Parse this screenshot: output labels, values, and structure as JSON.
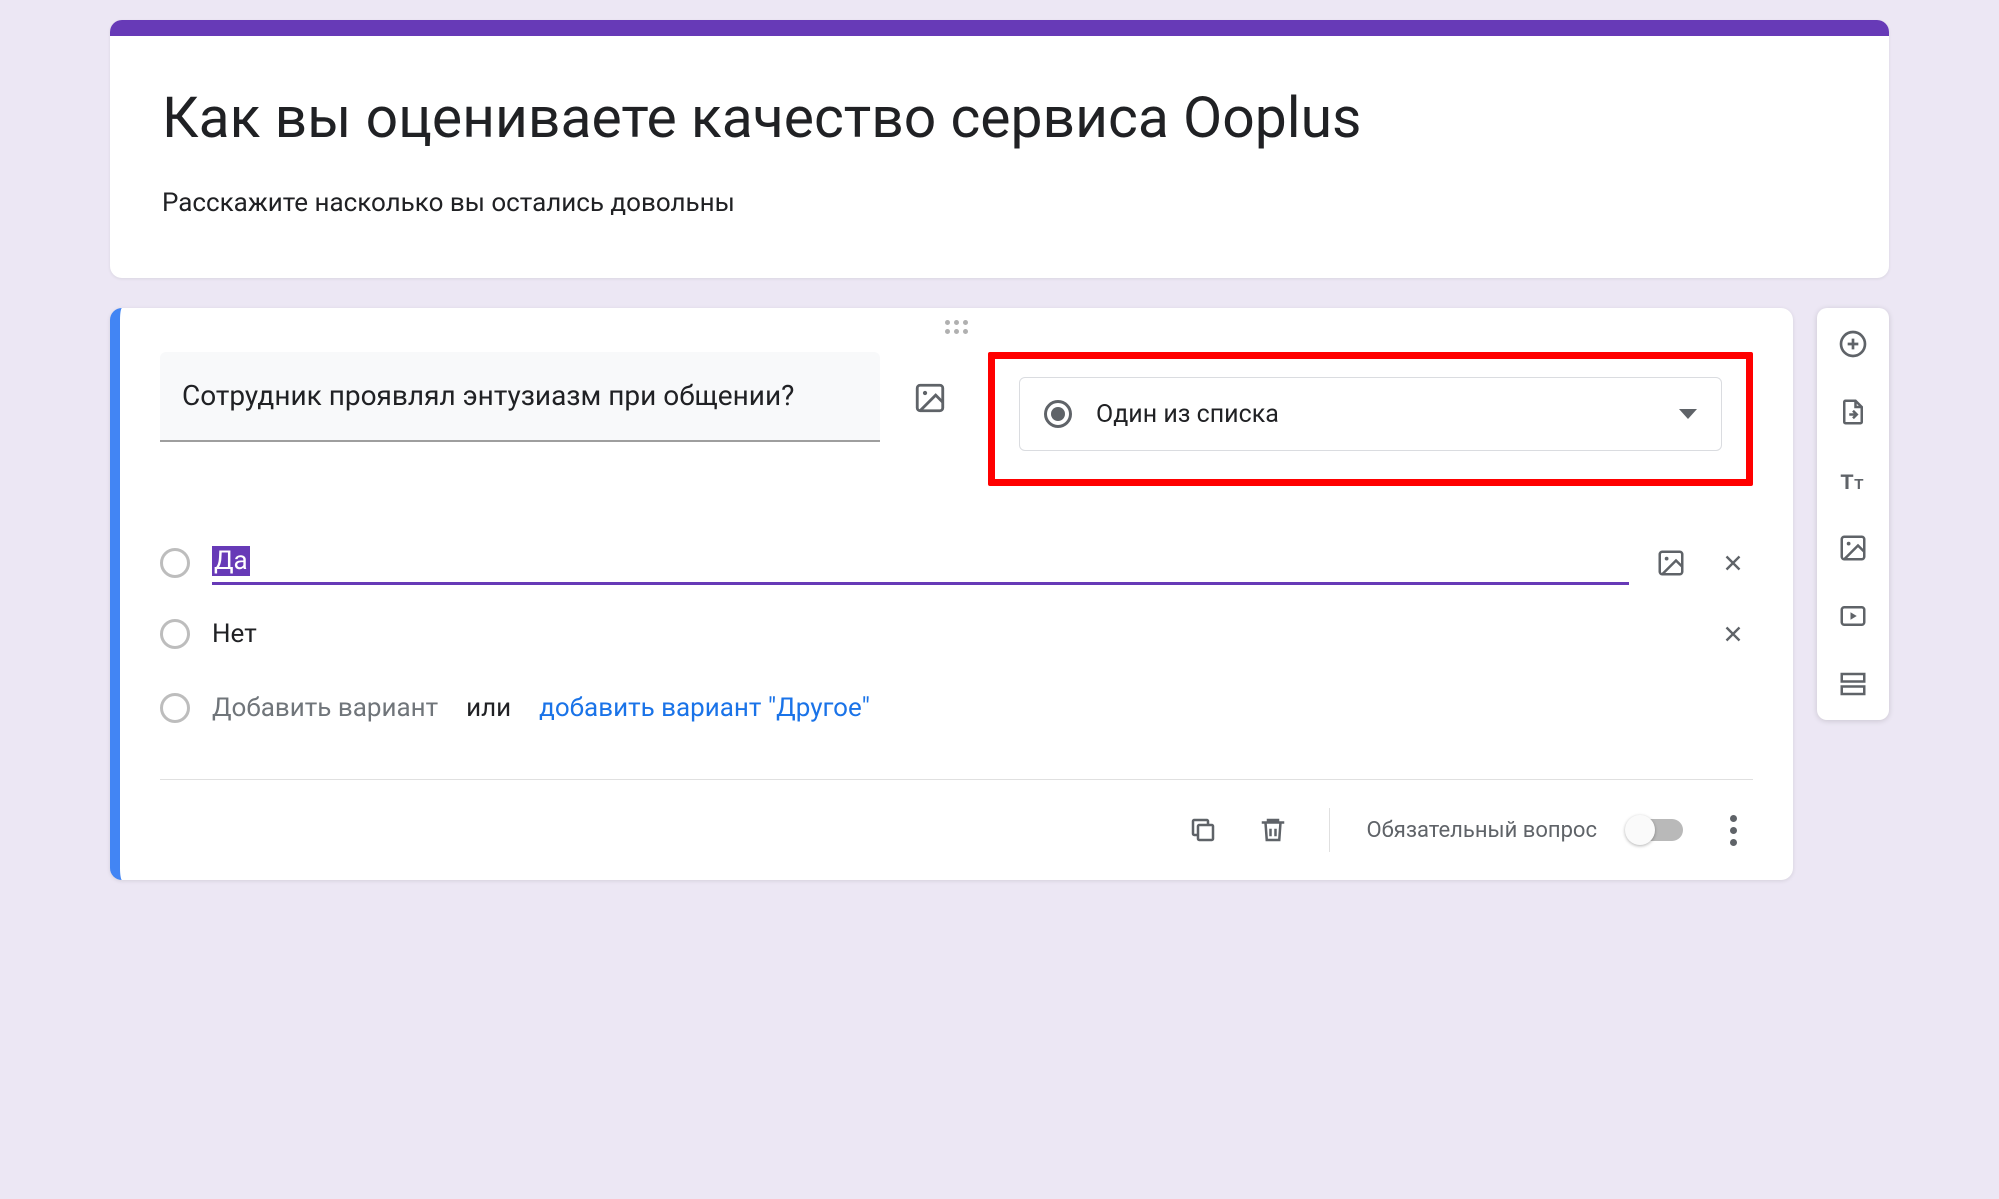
{
  "header": {
    "title": "Как вы оцениваете качество сервиса Ooplus",
    "description": "Расскажите насколько вы остались довольны"
  },
  "question": {
    "text": "Сотрудник проявлял энтузиазм при общении?",
    "type_label": "Один из списка",
    "options": [
      {
        "label": "Да",
        "selected": true
      },
      {
        "label": "Нет",
        "selected": false
      }
    ],
    "add_option_text": "Добавить вариант",
    "or_text": "или",
    "add_other_text": "добавить вариант \"Другое\""
  },
  "footer": {
    "required_label": "Обязательный вопрос",
    "required_on": false
  },
  "toolbar": {
    "items": [
      "add",
      "import",
      "title",
      "image",
      "video",
      "section"
    ]
  }
}
